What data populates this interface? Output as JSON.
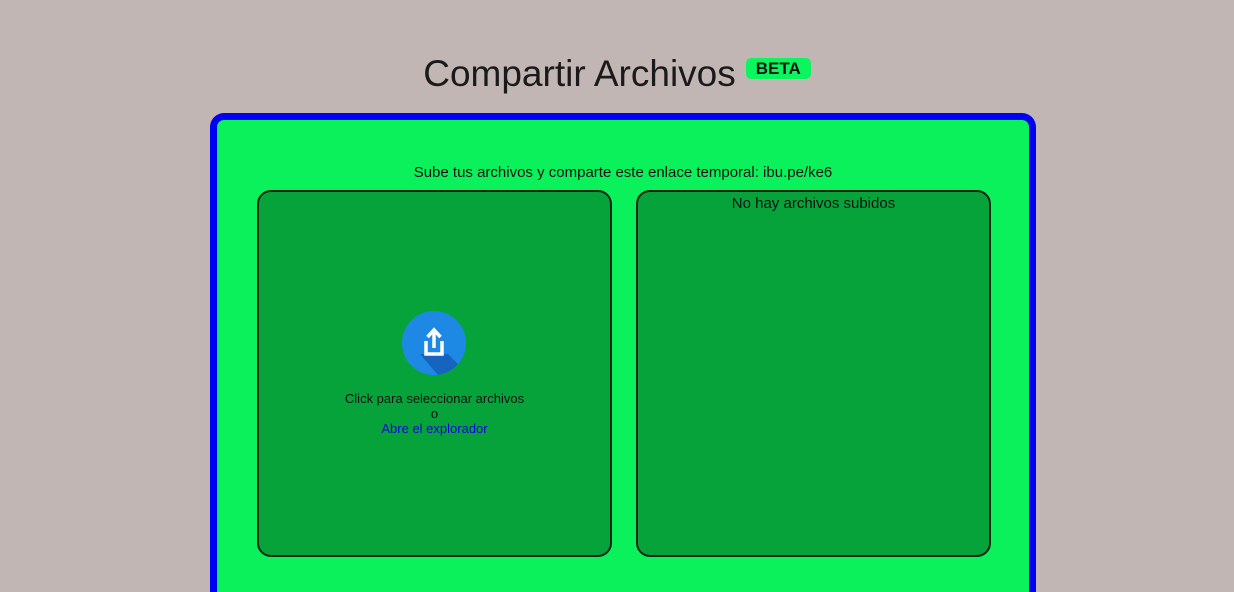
{
  "header": {
    "title": "Compartir Archivos",
    "badge": "BETA"
  },
  "share": {
    "text": "Sube tus archivos y comparte este enlace temporal: ibu.pe/ke6"
  },
  "dropzone": {
    "icon": "upload-icon",
    "select_text": "Click para seleccionar archivos",
    "or_text": "o",
    "explorer_link": "Abre el explorador"
  },
  "files": {
    "empty_message": "No hay archivos subidos"
  },
  "colors": {
    "background": "#c2b6b5",
    "panel_fill": "#0af15b",
    "panel_border": "#0000f2",
    "zone_fill": "#06a33a",
    "badge_fill": "#0bf55e",
    "link": "#0505d8",
    "icon_circle": "#1e88e5"
  }
}
